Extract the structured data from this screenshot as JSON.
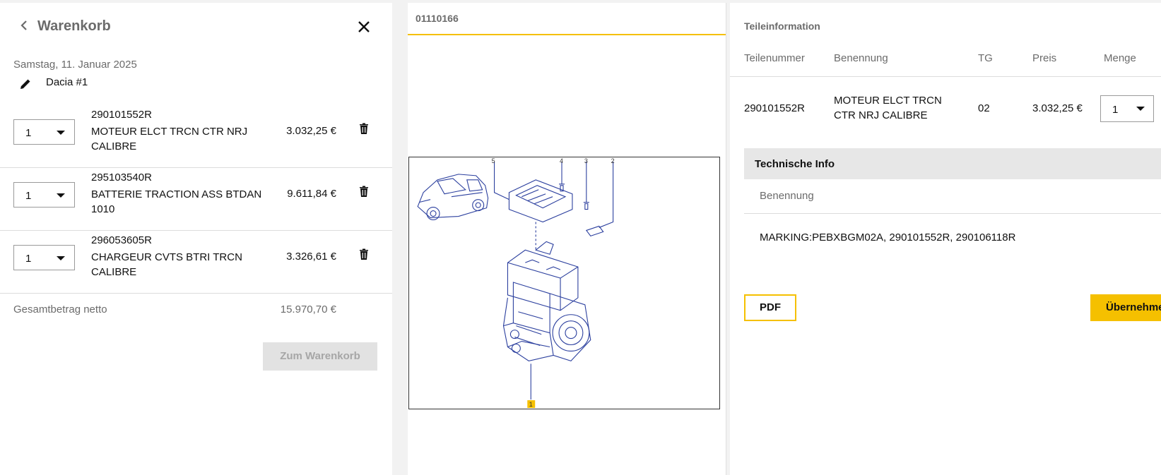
{
  "cart": {
    "title": "Warenkorb",
    "date": "Samstag, 11. Januar 2025",
    "vehicle": "Dacia #1",
    "items": [
      {
        "qty": "1",
        "part_no": "290101552R",
        "name": "MOTEUR ELCT TRCN CTR NRJ CALIBRE",
        "price": "3.032,25 €"
      },
      {
        "qty": "1",
        "part_no": "295103540R",
        "name": "BATTERIE TRACTION ASS BTDAN 1010",
        "price": "9.611,84 €"
      },
      {
        "qty": "1",
        "part_no": "296053605R",
        "name": "CHARGEUR CVTS BTRI TRCN CALIBRE",
        "price": "3.326,61 €"
      }
    ],
    "total_label": "Gesamtbetrag netto",
    "total_value": "15.970,70 €",
    "to_cart_button": "Zum Warenkorb"
  },
  "diagram": {
    "tab_label": "01110166",
    "callouts": [
      "5",
      "4",
      "3",
      "2",
      "1"
    ]
  },
  "part_info": {
    "title": "Teileinformation",
    "columns": [
      "Teilenummer",
      "Benennung",
      "TG",
      "Preis",
      "Menge"
    ],
    "row": {
      "part_no": "290101552R",
      "name_line1": "MOTEUR ELCT TRCN",
      "name_line2": "CTR NRJ CALIBRE",
      "tg": "02",
      "price": "3.032,25 €",
      "qty": "1"
    },
    "tech_info_title": "Technische Info",
    "tech_label": "Benennung",
    "tech_value": "MARKING:PEBXBGM02A, 290101552R, 290106118R",
    "pdf_button": "PDF",
    "apply_button": "Übernehmen"
  },
  "colors": {
    "accent": "#f5c000",
    "drawing": "#2b3f9e"
  }
}
